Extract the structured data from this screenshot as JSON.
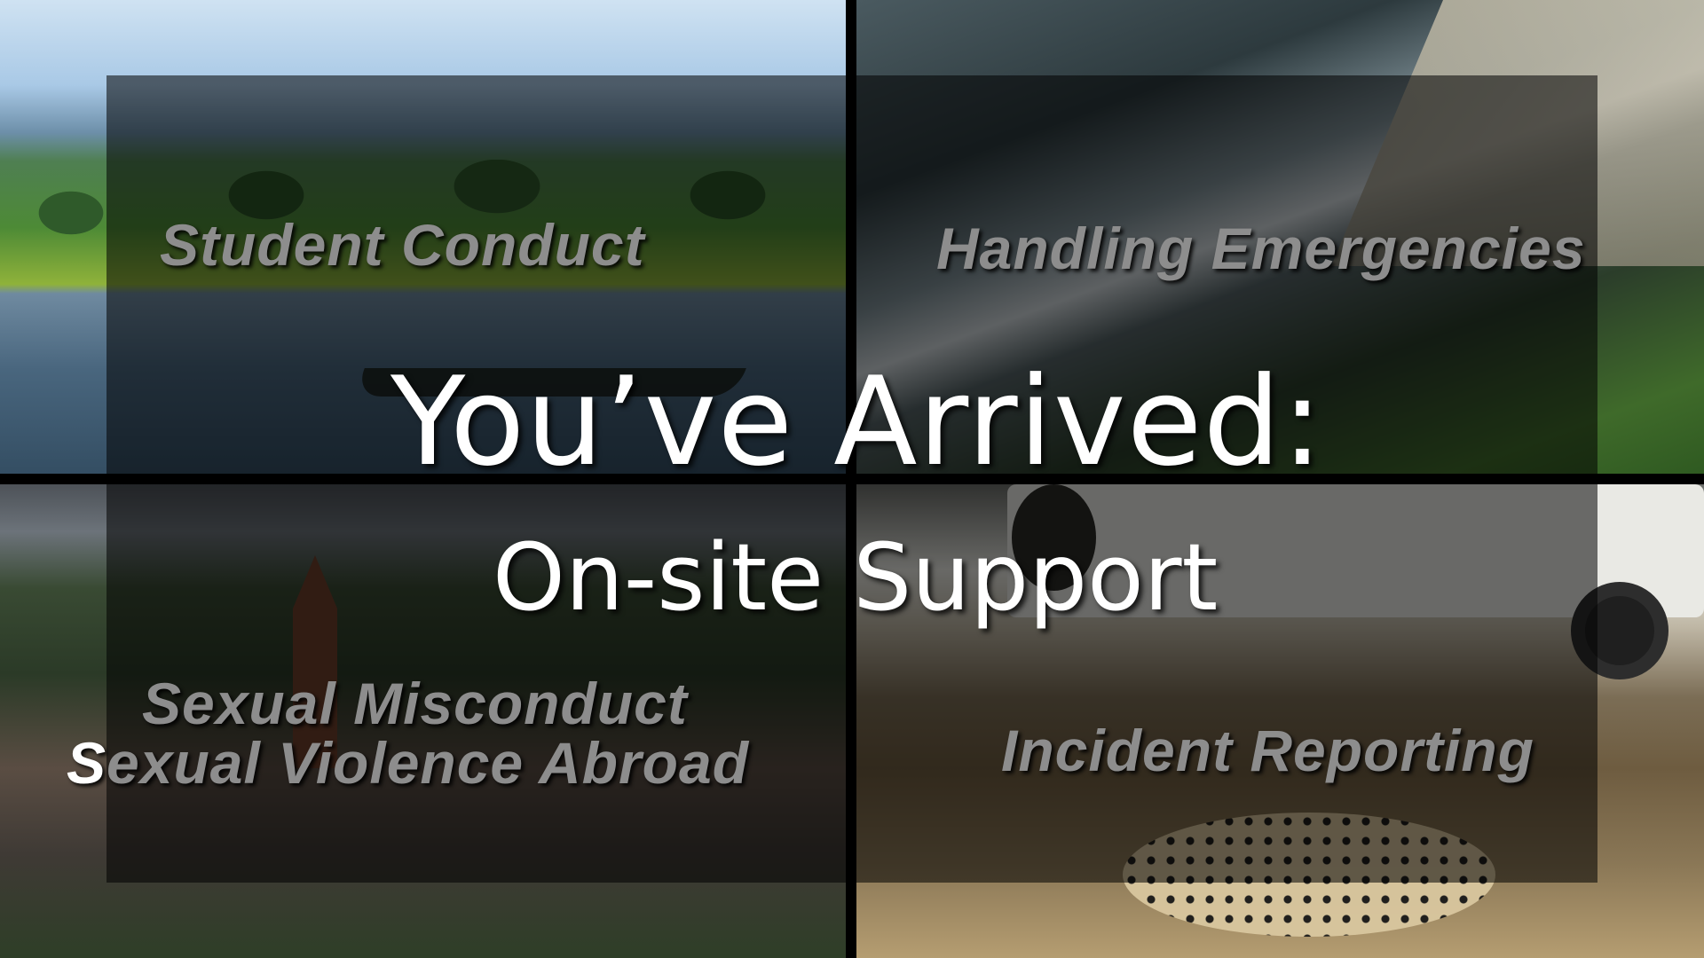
{
  "slide": {
    "title": "You’ve Arrived:",
    "subtitle": "On-site Support"
  },
  "quadrants": {
    "top_left": {
      "label": "Student Conduct"
    },
    "top_right": {
      "label": "Handling Emergencies"
    },
    "bottom_left": {
      "label_line1": "Sexual Misconduct",
      "label_line2_first": "S",
      "label_line2_rest": "exual Violence Abroad"
    },
    "bottom_right": {
      "label": "Incident Reporting"
    }
  },
  "colors": {
    "label_gray": "#8d8d8d",
    "title_white": "#ffffff",
    "overlay": "rgba(0,0,0,0.55)"
  }
}
